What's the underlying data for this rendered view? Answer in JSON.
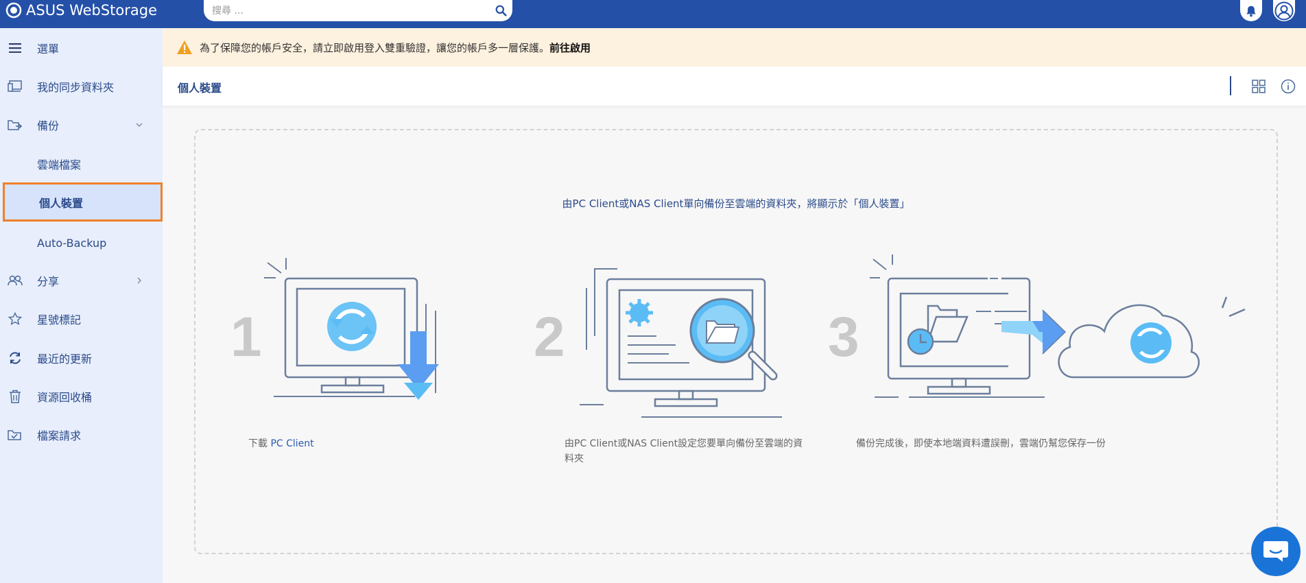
{
  "app": {
    "title": "ASUS WebStorage"
  },
  "search": {
    "placeholder": "搜尋 ..."
  },
  "icons": {
    "logo": "asus-logo-icon",
    "search": "search-icon",
    "bell": "bell-icon",
    "user": "user-avatar-icon",
    "menu": "hamburger-menu-icon",
    "warning": "warning-icon",
    "grid": "grid-view-icon",
    "info": "info-icon",
    "chat": "chat-icon"
  },
  "sidebar": {
    "items": [
      {
        "label": "選單",
        "icon": "hamburger-menu-icon"
      },
      {
        "label": "我的同步資料夾",
        "icon": "sync-folder-icon"
      },
      {
        "label": "備份",
        "icon": "backup-icon",
        "expanded": true
      },
      {
        "label": "雲端檔案",
        "sub": true
      },
      {
        "label": "個人裝置",
        "sub": true,
        "active": true
      },
      {
        "label": "Auto-Backup",
        "sub": true
      },
      {
        "label": "分享",
        "icon": "share-icon"
      },
      {
        "label": "星號標記",
        "icon": "star-icon"
      },
      {
        "label": "最近的更新",
        "icon": "recent-updates-icon"
      },
      {
        "label": "資源回收桶",
        "icon": "trash-icon"
      },
      {
        "label": "檔案請求",
        "icon": "file-request-icon"
      }
    ]
  },
  "alert": {
    "text": "為了保障您的帳戶安全，請立即啟用登入雙重驗證，讓您的帳戶多一層保護。",
    "action": "前往啟用"
  },
  "page": {
    "title": "個人裝置"
  },
  "empty_state": {
    "message": "由PC Client或NAS Client單向備份至雲端的資料夾，將顯示於「個人裝置」",
    "steps": [
      {
        "number": "1",
        "caption_prefix": "下載 ",
        "caption_link": "PC Client"
      },
      {
        "number": "2",
        "caption_line1": "由PC Client或NAS Client設定您要單向備份至雲端的資",
        "caption_line2": "料夾"
      },
      {
        "number": "3",
        "caption": "備份完成後，即使本地端資料遭誤刪，雲端仍幫您保存一份"
      }
    ]
  },
  "colors": {
    "header": "#2450a8",
    "sidebar_bg": "#e8eefb",
    "active_outline": "#f07f2a",
    "alert_bg": "#fdf1df",
    "accent_blue": "#5bbcf5",
    "chat": "#1a74d8"
  }
}
